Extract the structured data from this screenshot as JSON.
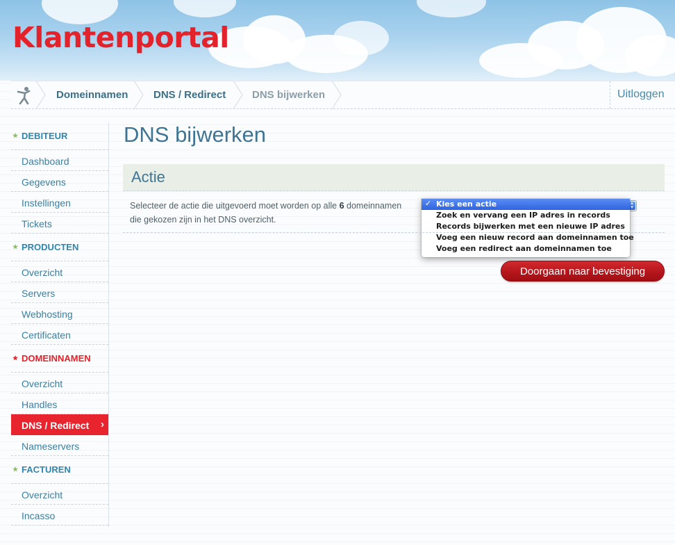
{
  "header": {
    "logo_text": "Klantenportal"
  },
  "breadcrumb": {
    "items": [
      {
        "label": "Domeinnamen"
      },
      {
        "label": "DNS / Redirect"
      },
      {
        "label": "DNS bijwerken"
      }
    ],
    "logout_label": "Uitloggen"
  },
  "sidebar": {
    "sections": [
      {
        "heading": "DEBITEUR",
        "items": [
          "Dashboard",
          "Gegevens",
          "Instellingen",
          "Tickets"
        ]
      },
      {
        "heading": "PRODUCTEN",
        "items": [
          "Overzicht",
          "Servers",
          "Webhosting",
          "Certificaten"
        ]
      },
      {
        "heading": "DOMEINNAMEN",
        "items": [
          "Overzicht",
          "Handles",
          "DNS / Redirect",
          "Nameservers"
        ]
      },
      {
        "heading": "FACTUREN",
        "items": [
          "Overzicht",
          "Incasso"
        ]
      }
    ]
  },
  "main": {
    "title": "DNS bijwerken",
    "section_title": "Actie",
    "description_part1": "Selecteer de actie die uitgevoerd moet worden op alle ",
    "description_count": "6",
    "description_part2": " domeinnamen die gekozen zijn in het DNS overzicht.",
    "action_select": {
      "selected": "Kies een actie",
      "options": [
        "Kies een actie",
        "Zoek en vervang een IP adres in records",
        "Records bijwerken met een nieuwe IP adres",
        "Voeg een nieuw record aan domeinnamen toe",
        "Voeg een redirect aan domeinnamen toe"
      ]
    },
    "continue_button": "Doorgaan naar bevestiging"
  },
  "colors": {
    "brand_red": "#e3232c",
    "link_blue": "#3c7f9e",
    "button_red": "#b3151b"
  }
}
